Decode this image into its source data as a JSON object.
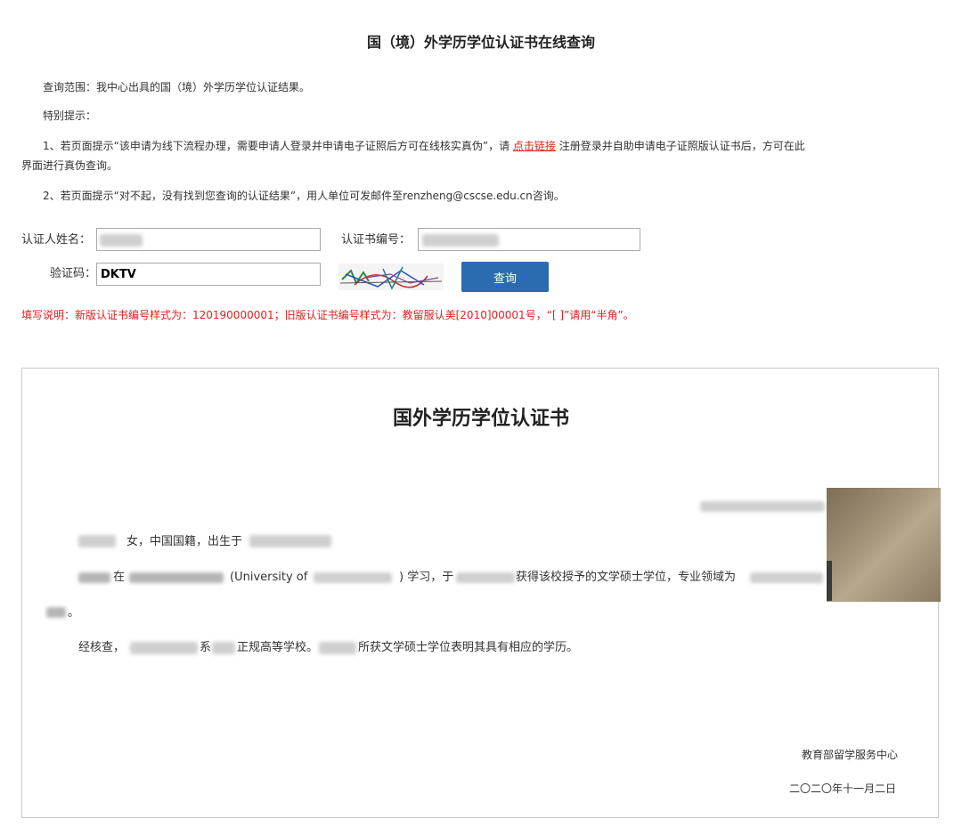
{
  "header": {
    "title": "国（境）外学历学位认证书在线查询"
  },
  "notice": {
    "scope": "查询范围：我中心出具的国（境）外学历学位认证结果。",
    "tip_heading": "特别提示：",
    "tip1_part1": "1、若页面提示“该申请为线下流程办理，需要申请人登录并申请电子证照后方可在线核实真伪”，请",
    "tip1_link": "点击链接",
    "tip1_part2": "注册登录并自助申请电子证照版认证书后，方可在此",
    "tip1_part3": "界面进行真伪查询。",
    "tip2": "2、若页面提示“对不起，没有找到您查询的认证结果”，用人单位可发邮件至renzheng@cscse.edu.cn咨询。"
  },
  "form": {
    "name_label": "认证人姓名：",
    "cert_no_label": "认证书编号：",
    "captcha_label": "验证码：",
    "captcha_value": "DKTV",
    "query_button": "查询",
    "fill_tip": "填写说明：新版认证书编号样式为：120190000001；旧版认证书编号样式为：教留服认美[2010]00001号，“[ ]”请用“半角”。"
  },
  "certificate": {
    "title": "国外学历学位认证书",
    "line1_text": "女，中国国籍，出生于",
    "line2_in": "在",
    "line2_univ": "(University of",
    "line2_study": ")  学习，于",
    "line2_degree": "获得该校授予的文学硕士学位，专业领域为",
    "line3_end": "。",
    "line4_start": "经核查，",
    "line4_xi": "系",
    "line4_school": "正规高等学校。",
    "line4_end": "所获文学硕士学位表明其具有相应的学历。",
    "issuer": "教育部留学服务中心",
    "date": "二〇二〇年十一月二日"
  },
  "colors": {
    "accent_blue": "#2b6cb0",
    "warning_red": "#e02020"
  }
}
